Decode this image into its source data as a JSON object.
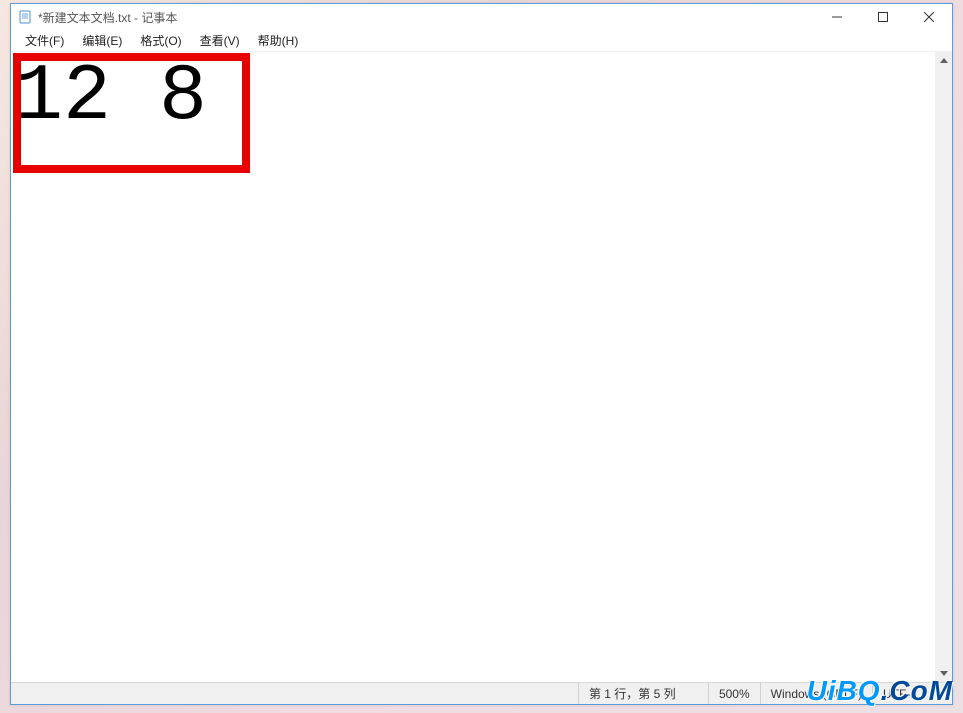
{
  "titlebar": {
    "title": "*新建文本文档.txt - 记事本"
  },
  "menu": {
    "file": "文件(F)",
    "edit": "编辑(E)",
    "format": "格式(O)",
    "view": "查看(V)",
    "help": "帮助(H)"
  },
  "editor": {
    "content": "12 8"
  },
  "statusbar": {
    "position": "第 1 行，第 5 列",
    "zoom": "500%",
    "line_ending": "Windows (CRLF)",
    "encoding": "UTF-8"
  },
  "watermark": {
    "part1": "UiBQ",
    "part2": ".CoM"
  }
}
